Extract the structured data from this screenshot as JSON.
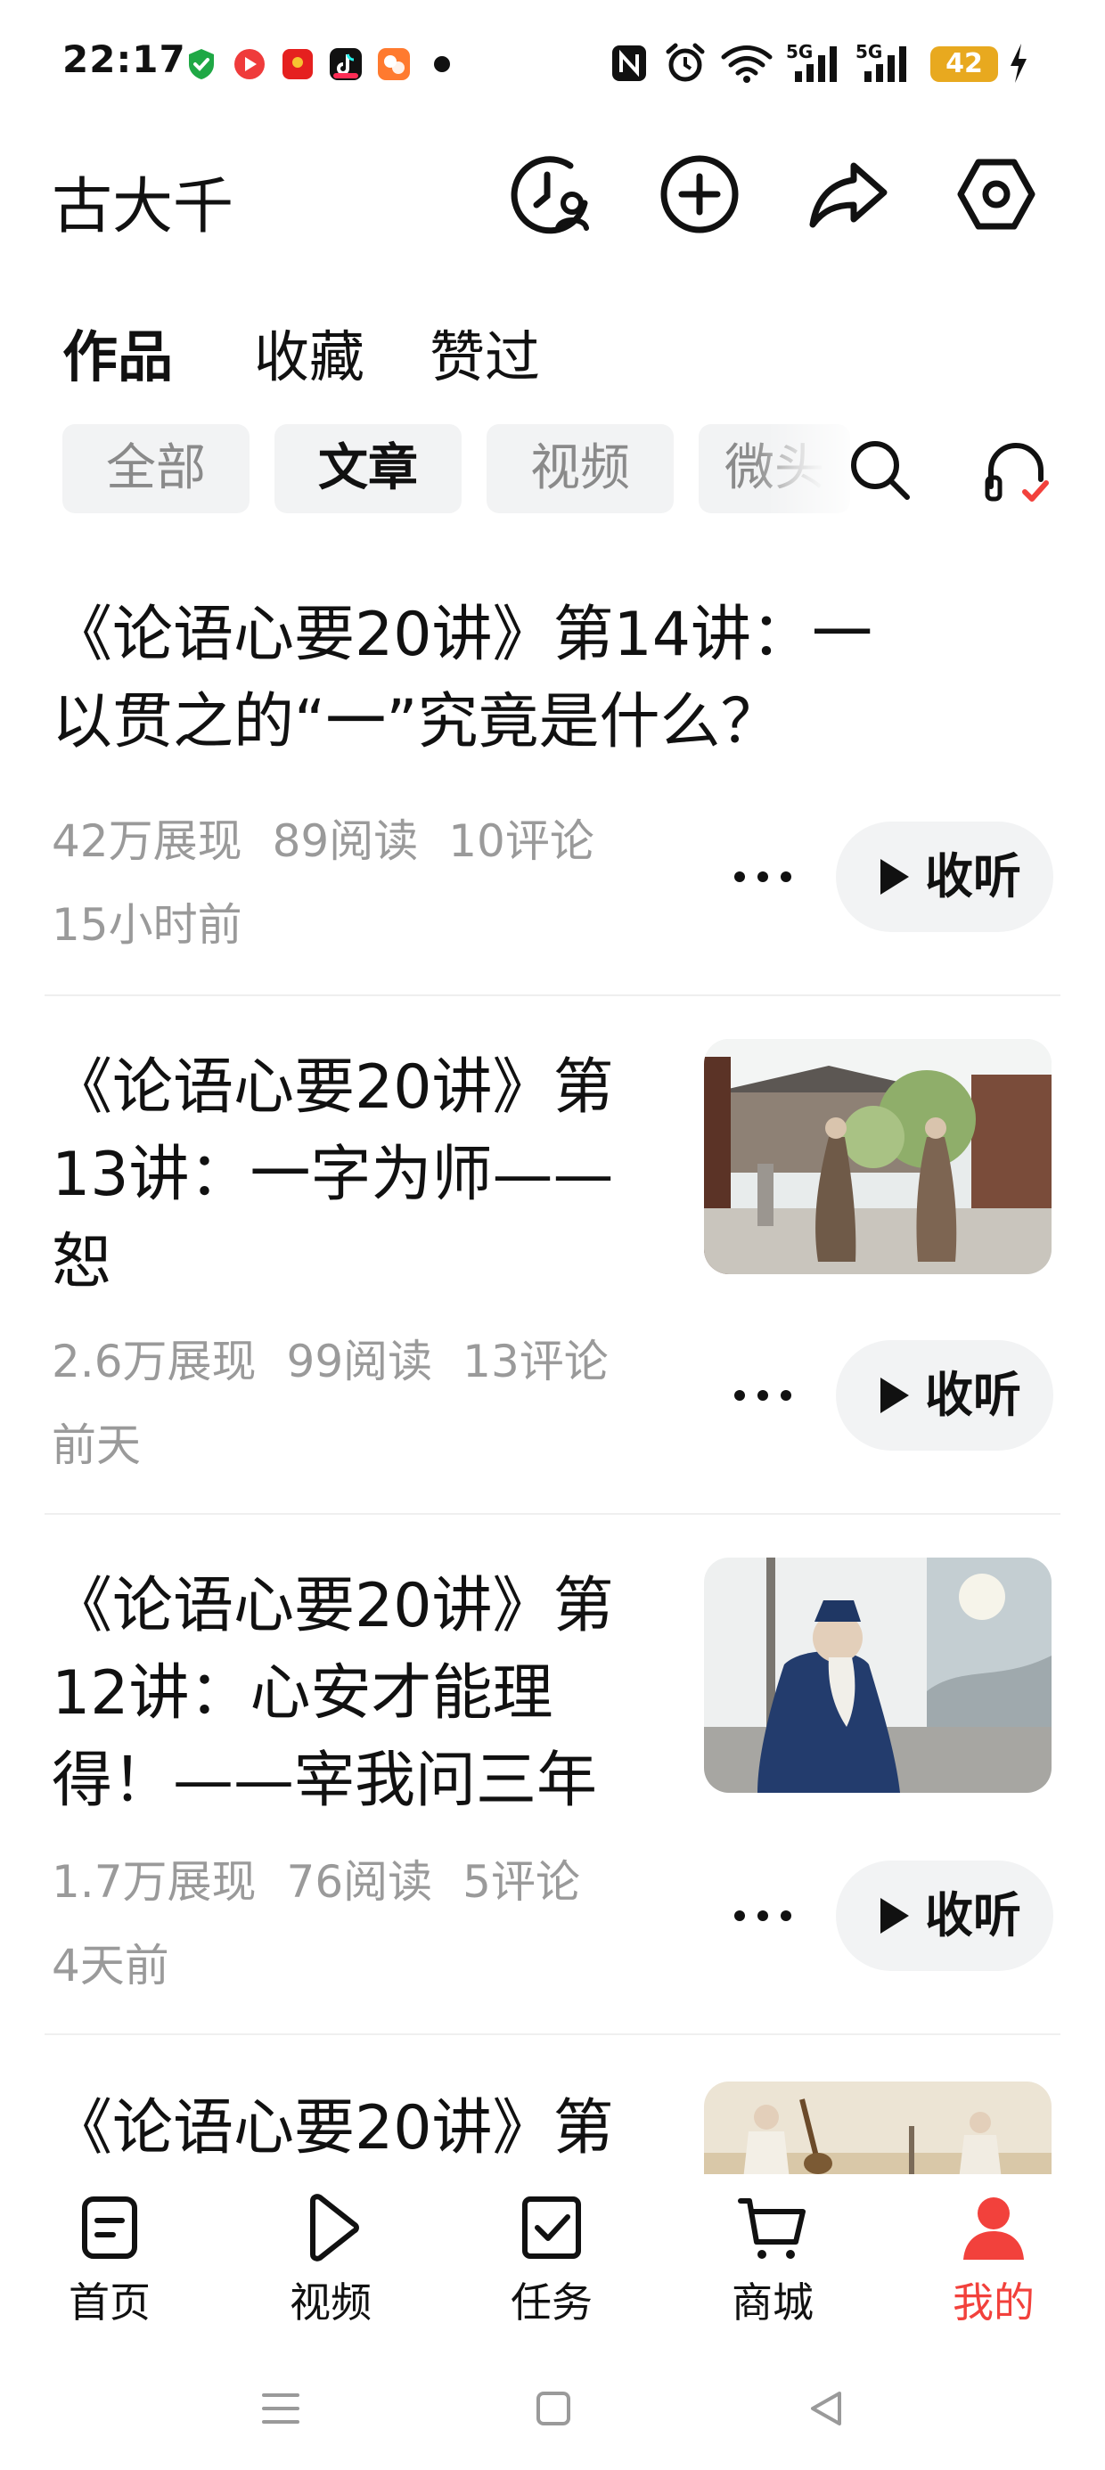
{
  "status_bar": {
    "time": "22:17",
    "battery": "42",
    "network_1": "5G",
    "network_2": "5G",
    "icons": [
      "shield-icon",
      "record-icon",
      "red-packet-icon",
      "tiktok-icon",
      "photos-icon",
      "dot-icon",
      "nfc-icon",
      "alarm-icon",
      "wifi-icon",
      "signal-icon",
      "signal-icon",
      "battery-icon",
      "charging-icon"
    ]
  },
  "header": {
    "name": "古大千",
    "actions": [
      "history-icon",
      "add-icon",
      "share-icon",
      "settings-icon"
    ]
  },
  "tabs": [
    {
      "label": "作品",
      "active": true
    },
    {
      "label": "收藏",
      "active": false
    },
    {
      "label": "赞过",
      "active": false
    }
  ],
  "chips": [
    {
      "label": "全部",
      "active": false
    },
    {
      "label": "文章",
      "active": true
    },
    {
      "label": "视频",
      "active": false
    },
    {
      "label": "微头",
      "active": false
    }
  ],
  "chip_actions": [
    "search-icon",
    "headphones-icon"
  ],
  "feed": [
    {
      "title_lines": [
        "《论语心要20讲》第14讲：一",
        "以贯之的“一”究竟是什么？"
      ],
      "impressions": "42万展现",
      "reads": "89阅读",
      "comments": "10评论",
      "time": "15小时前",
      "listen_label": "收听",
      "has_thumbnail": false
    },
    {
      "title_lines": [
        "《论语心要20讲》第",
        "13讲：一字为师——",
        "恕"
      ],
      "impressions": "2.6万展现",
      "reads": "99阅读",
      "comments": "13评论",
      "time": "前天",
      "listen_label": "收听",
      "has_thumbnail": true
    },
    {
      "title_lines": [
        "《论语心要20讲》第",
        "12讲：心安才能理",
        "得！——宰我问三年"
      ],
      "impressions": "1.7万展现",
      "reads": "76阅读",
      "comments": "5评论",
      "time": "4天前",
      "listen_label": "收听",
      "has_thumbnail": true
    },
    {
      "title_lines": [
        "《论语心要20讲》第"
      ],
      "has_thumbnail": true
    }
  ],
  "bottom_nav": [
    {
      "label": "首页",
      "icon": "home-icon",
      "active": false
    },
    {
      "label": "视频",
      "icon": "play-icon",
      "active": false
    },
    {
      "label": "任务",
      "icon": "task-icon",
      "active": false
    },
    {
      "label": "商城",
      "icon": "cart-icon",
      "active": false
    },
    {
      "label": "我的",
      "icon": "person-icon",
      "active": true
    }
  ],
  "colors": {
    "accent": "#f2413c",
    "text": "#111111",
    "muted": "#9a9a9a",
    "chip_bg": "#f2f3f4",
    "battery": "#e8a91f"
  }
}
